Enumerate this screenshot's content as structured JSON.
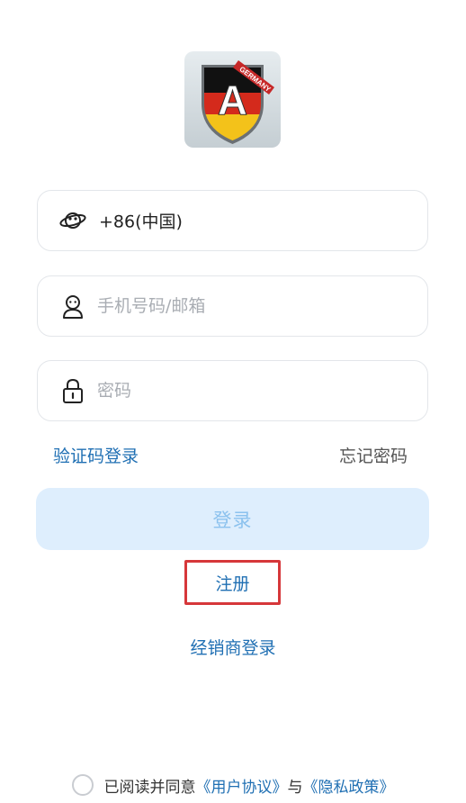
{
  "logo": {
    "badge_letter": "A",
    "badge_text": "GERMANY"
  },
  "country_field": {
    "value": "+86(中国)",
    "icon": "globe-icon"
  },
  "account_field": {
    "placeholder": "手机号码/邮箱",
    "icon": "user-icon"
  },
  "password_field": {
    "placeholder": "密码",
    "icon": "lock-icon"
  },
  "links": {
    "sms_login": "验证码登录",
    "forgot_password": "忘记密码"
  },
  "buttons": {
    "login": "登录",
    "register": "注册",
    "dealer_login": "经销商登录"
  },
  "agreement": {
    "prefix": "已阅读并同意",
    "user_agreement": "《用户协议》",
    "joiner": "与",
    "privacy_policy": "《隐私政策》"
  },
  "colors": {
    "accent": "#1f6fb3",
    "login_button_bg": "#deeefd",
    "login_button_text": "#8cc2ee",
    "highlight_border": "#d6373a"
  }
}
